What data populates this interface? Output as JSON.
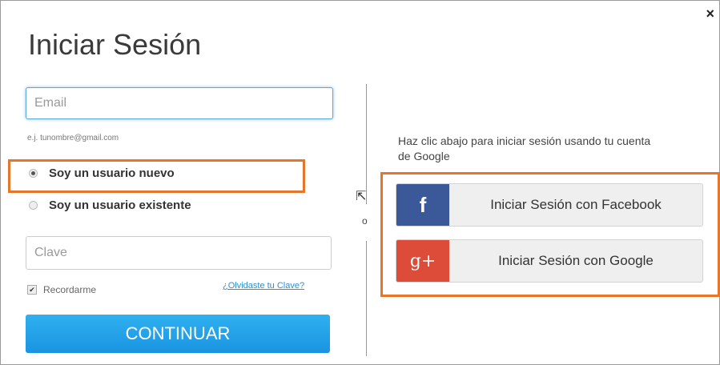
{
  "dialog": {
    "title": "Iniciar Sesión",
    "close_glyph": "×"
  },
  "form": {
    "email_placeholder": "Email",
    "email_hint": "e.j. tunombre@gmail.com",
    "radio_new_label": "Soy un usuario nuevo",
    "radio_existing_label": "Soy un usuario existente",
    "radio_selected": "new",
    "password_placeholder": "Clave",
    "remember_label": "Recordarme",
    "remember_checked": true,
    "forgot_link": "¿Olvidaste tu Clave?",
    "continue_label": "CONTINUAR"
  },
  "separator": {
    "or_text": "o"
  },
  "social": {
    "prompt": "Haz clic abajo para iniciar sesión usando tu cuenta de Google",
    "facebook": {
      "icon": "facebook-icon",
      "glyph": "f",
      "label": "Iniciar Sesión con Facebook",
      "color": "#3b5998"
    },
    "google": {
      "icon": "google-plus-icon",
      "glyph": "g+",
      "label": "Iniciar Sesión con Google",
      "color": "#dd4b39"
    }
  },
  "colors": {
    "highlight": "#e5762a",
    "primary": "#1a94e0",
    "link": "#2d8fd0"
  }
}
